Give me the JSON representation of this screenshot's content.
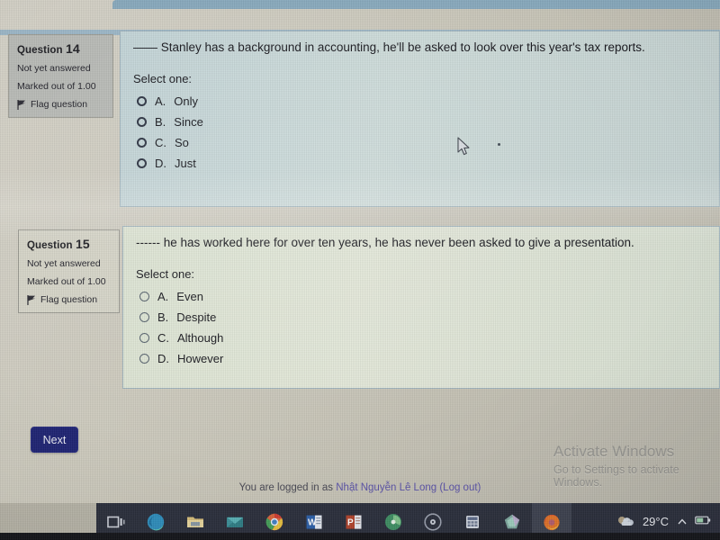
{
  "page": {
    "footer_prefix": "You are logged in as ",
    "footer_username": "Nhật Nguyễn Lê Long",
    "footer_logout": "(Log out)"
  },
  "next_button": {
    "label": "Next"
  },
  "watermark": {
    "title": "Activate Windows",
    "subtitle": "Go to Settings to activate Windows."
  },
  "questions": [
    {
      "title_label": "Question",
      "number": "14",
      "status": "Not yet answered",
      "marks": "Marked out of 1.00",
      "flag_label": "Flag question",
      "stem": "—— Stanley has a background in accounting, he'll be asked to look over this year's tax reports.",
      "select_label": "Select one:",
      "options": [
        {
          "letter": "A.",
          "text": "Only"
        },
        {
          "letter": "B.",
          "text": "Since"
        },
        {
          "letter": "C.",
          "text": "So"
        },
        {
          "letter": "D.",
          "text": "Just"
        }
      ]
    },
    {
      "title_label": "Question",
      "number": "15",
      "status": "Not yet answered",
      "marks": "Marked out of 1.00",
      "flag_label": "Flag question",
      "stem": "------ he has worked here for over ten years, he has never been asked to give a presentation.",
      "select_label": "Select one:",
      "options": [
        {
          "letter": "A.",
          "text": "Even"
        },
        {
          "letter": "B.",
          "text": "Despite"
        },
        {
          "letter": "C.",
          "text": "Although"
        },
        {
          "letter": "D.",
          "text": "However"
        }
      ]
    }
  ],
  "taskbar": {
    "items": [
      {
        "name": "task-view-icon",
        "label": "Task View"
      },
      {
        "name": "microsoft-edge-icon",
        "label": "Microsoft Edge"
      },
      {
        "name": "file-explorer-icon",
        "label": "File Explorer"
      },
      {
        "name": "mail-icon",
        "label": "Mail"
      },
      {
        "name": "google-chrome-icon",
        "label": "Google Chrome"
      },
      {
        "name": "word-icon",
        "label": "Microsoft Word"
      },
      {
        "name": "powerpoint-icon",
        "label": "Microsoft PowerPoint"
      },
      {
        "name": "app-green-icon",
        "label": "App"
      },
      {
        "name": "media-player-icon",
        "label": "Media Player"
      },
      {
        "name": "calculator-icon",
        "label": "Calculator"
      },
      {
        "name": "unity-icon",
        "label": "Unity"
      },
      {
        "name": "firefox-icon",
        "label": "Mozilla Firefox"
      }
    ],
    "tray": {
      "weather_icon": "cloud-icon",
      "temperature": "29°C",
      "chevron": "chevron-up-icon",
      "battery_icon": "battery-icon"
    }
  },
  "colors": {
    "accent_button": "#1f2474",
    "question_panel_tint": "#c9d8da",
    "question_panel_pale": "#dee6d6",
    "info_box_shaded": "#b9bbb7",
    "info_box_plain": "#d6d5c8",
    "link": "#5a52a8",
    "taskbar": "#2b2f3c"
  }
}
